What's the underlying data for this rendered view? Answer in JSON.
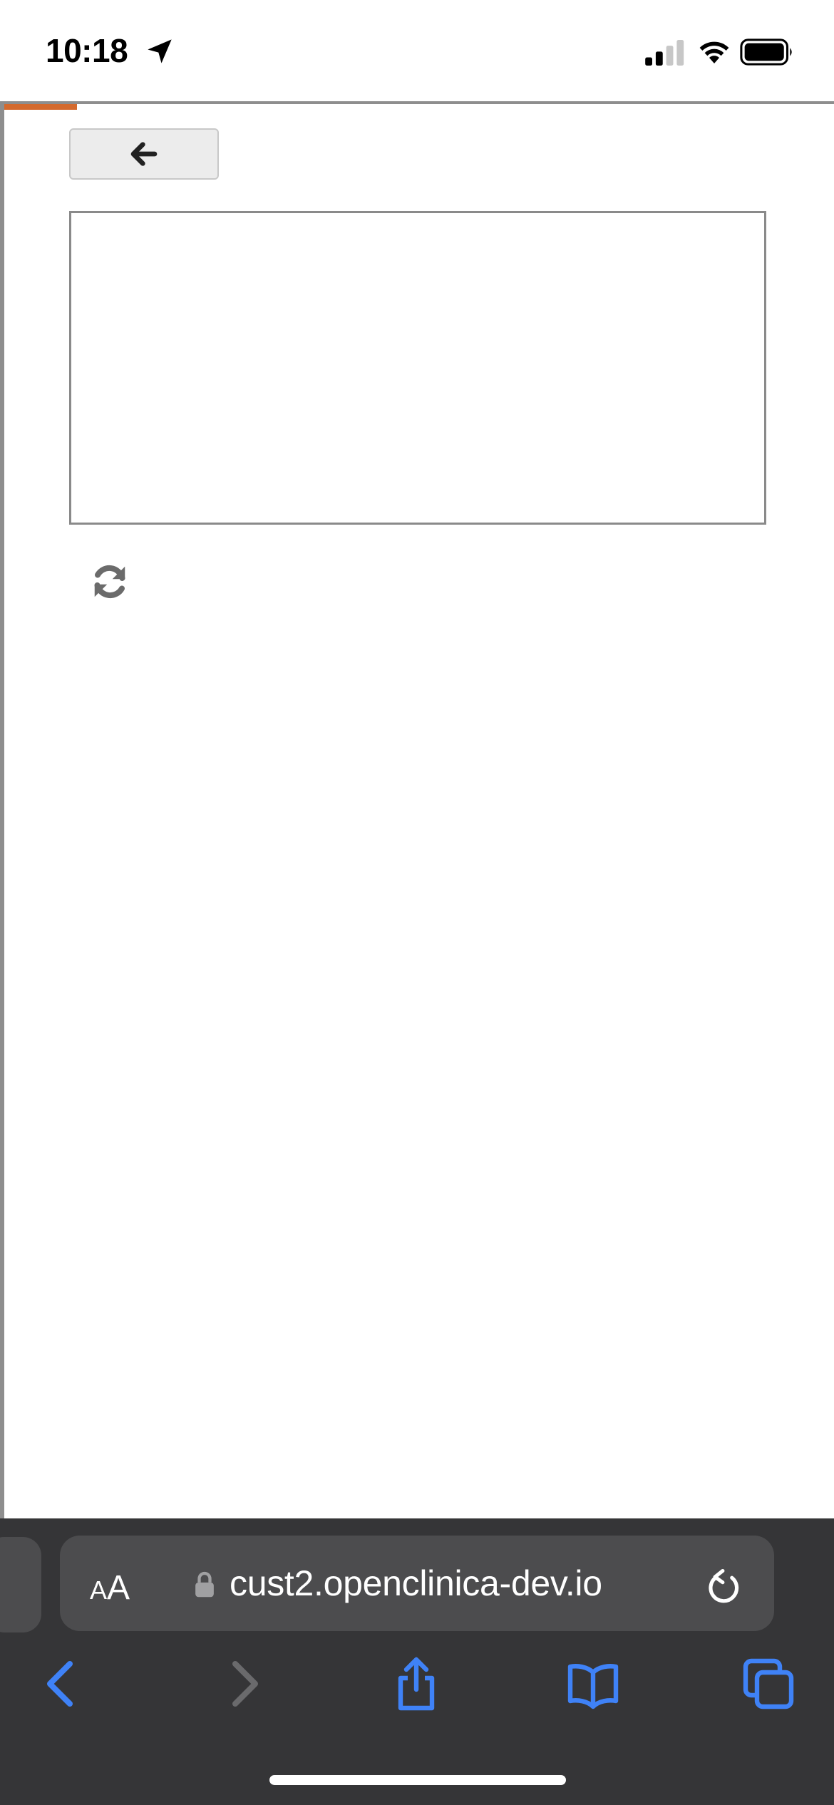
{
  "status_bar": {
    "time": "10:18",
    "icons": [
      "location-arrow-icon",
      "cellular-signal-icon",
      "wifi-icon",
      "battery-icon"
    ]
  },
  "page": {
    "accent_color": "#d46a2e",
    "back_button_icon": "arrow-left-icon",
    "refresh_icon": "refresh-icon"
  },
  "browser": {
    "text_size_label_small": "A",
    "text_size_label_big": "A",
    "url": "cust2.openclinica-dev.io",
    "toolbar": [
      "back-icon",
      "forward-icon",
      "share-icon",
      "bookmarks-icon",
      "tabs-icon"
    ],
    "accent_color": "#3f82f7"
  }
}
